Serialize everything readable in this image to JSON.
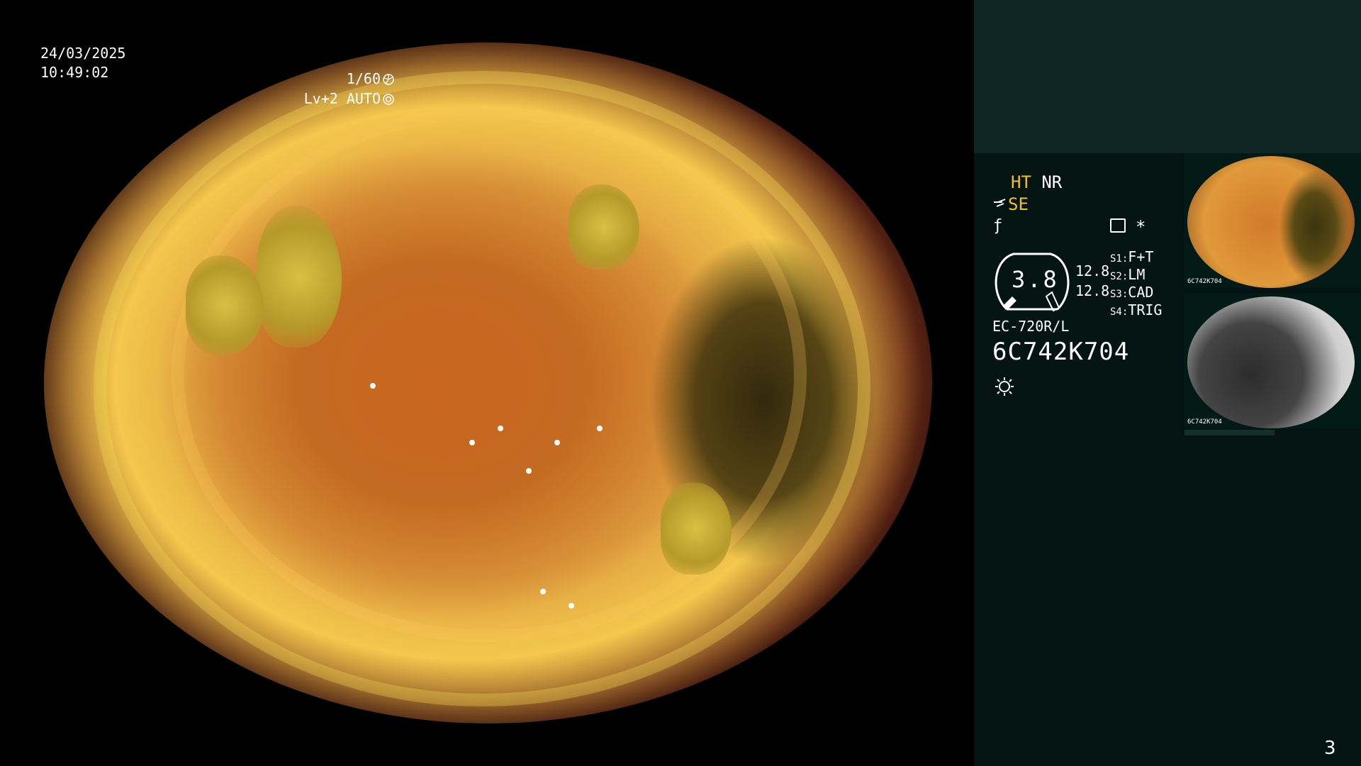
{
  "overlay": {
    "date": "24/03/2025",
    "time": "10:49:02",
    "shutter": "1/60",
    "level": "Lv+2 AUTO"
  },
  "panel": {
    "ht": "HT",
    "nr": "NR",
    "se": "SE",
    "fm_symbol": "ƒ",
    "asterisk": "*",
    "gauge_value": "3.8",
    "scale1": "12.8",
    "scale2": "12.8",
    "switches": [
      {
        "key": "S1:",
        "value": "F+T"
      },
      {
        "key": "S2:",
        "value": "LM"
      },
      {
        "key": "S3:",
        "value": "CAD"
      },
      {
        "key": "S4:",
        "value": "TRIG"
      }
    ],
    "model": "EC-720R/L",
    "serial": "6C742K704"
  },
  "thumbnails": [
    {
      "label": "6C742K704"
    },
    {
      "label": "6C742K704"
    }
  ],
  "page_number": "3",
  "colors": {
    "panel_bg": "#041412",
    "top_strip": "#0f2625",
    "accent_yellow": "#f3c21a"
  },
  "icons": [
    "shutter-icon",
    "auto-iris-icon",
    "wind-icon",
    "memo-icon",
    "light-source-icon"
  ]
}
